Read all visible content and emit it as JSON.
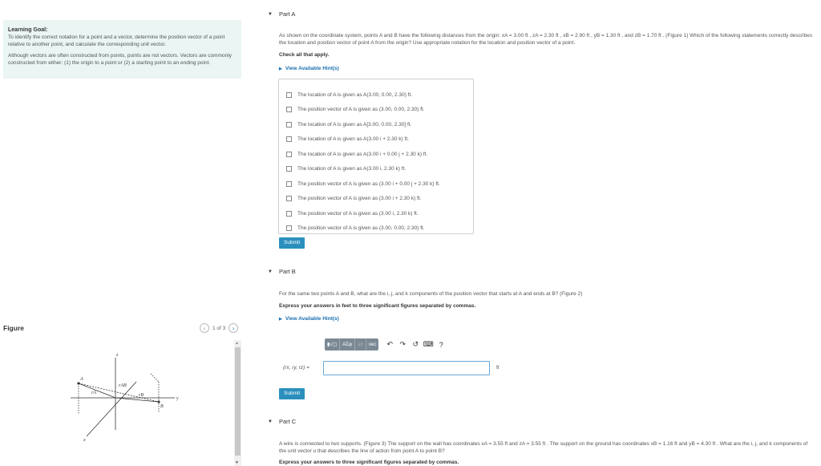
{
  "learning_goal": {
    "title": "Learning Goal:",
    "p1": "To identify the correct notation for a point and a vector, determine the position vector of a point relative to another point, and calculate the corresponding unit vector.",
    "p2": "Although vectors are often constructed from points, points are not vectors. Vectors are commonly constructed from either: (1) the origin to a point or (2) a starting point to an ending point."
  },
  "figure": {
    "label": "Figure",
    "pager": "1 of 3",
    "labels": {
      "z": "z",
      "y": "y",
      "x": "x",
      "A": "A",
      "B": "B",
      "rA": "rA",
      "rB": "rB",
      "rAB": "rAB"
    }
  },
  "part_a": {
    "title": "Part A",
    "question": "As shown on the coordinate system, points A and B have the following distances from the origin: xA = 3.00 ft , zA = 2.30 ft , xB = 2.90 ft , yB = 1.30 ft , and zB = 1.70 ft . (Figure 1) Which of the following statements correctly describes the location and position vector of point A from the origin? Use appropriate notation for the location and position vector of a point.",
    "instruction": "Check all that apply.",
    "hint": "View Available Hint(s)",
    "choices": [
      "The location of A is given as A(3.00, 0.00, 2.30) ft.",
      "The position vector of A is given as (3.00, 0.00, 2.30) ft.",
      "The location of A is given as A[3.00, 0.00, 2.30] ft.",
      "The location of A is given as A(3.00 i + 2.30 k) ft.",
      "The location of A is given as A(3.00 i + 0.00 j + 2.30 k) ft.",
      "The location of A is given as A(3.00 i, 2.30 k) ft.",
      "The position vector of A is given as (3.00 i + 0.00 j + 2.30 k) ft.",
      "The position vector of A is given as (3.00 i + 2.30 k) ft.",
      "The position vector of A is given as (3.00 i, 2.30 k) ft.",
      "The position vector of A is given as (3.00, 0.00, 2.30) ft."
    ],
    "submit": "Submit"
  },
  "part_b": {
    "title": "Part B",
    "question": "For the same two points A and B, what are the i, j, and k components of the position vector that starts at A and ends at B? (Figure 2)",
    "instruction": "Express your answers in feet to three significant figures separated by commas.",
    "hint": "View Available Hint(s)",
    "toolbar": {
      "templates": "▮√▢",
      "greek": "ΑΣφ",
      "arrows": "↓↑",
      "vec": "vec",
      "undo": "↶",
      "redo": "↷",
      "reset": "↺",
      "keyboard": "⌨",
      "help": "?"
    },
    "eq_label": "(rx, ry, rz) =",
    "answer_value": "",
    "unit": "ft",
    "submit": "Submit"
  },
  "part_c": {
    "title": "Part C",
    "question": "A wire is connected to two supports. (Figure 3) The support on the wall has coordinates xA = 3.55 ft and zA = 3.55 ft . The support on the ground has coordinates xB = 1.16 ft and yB = 4.30 ft . What are the i, j, and k components of the unit vector u that describes the line of action from point A to point B?",
    "instruction": "Express your answers to three significant figures separated by commas."
  },
  "colors": {
    "accent": "#2a8fbd",
    "goal_bg": "#eaf5f4",
    "link": "#2a7ab5"
  }
}
